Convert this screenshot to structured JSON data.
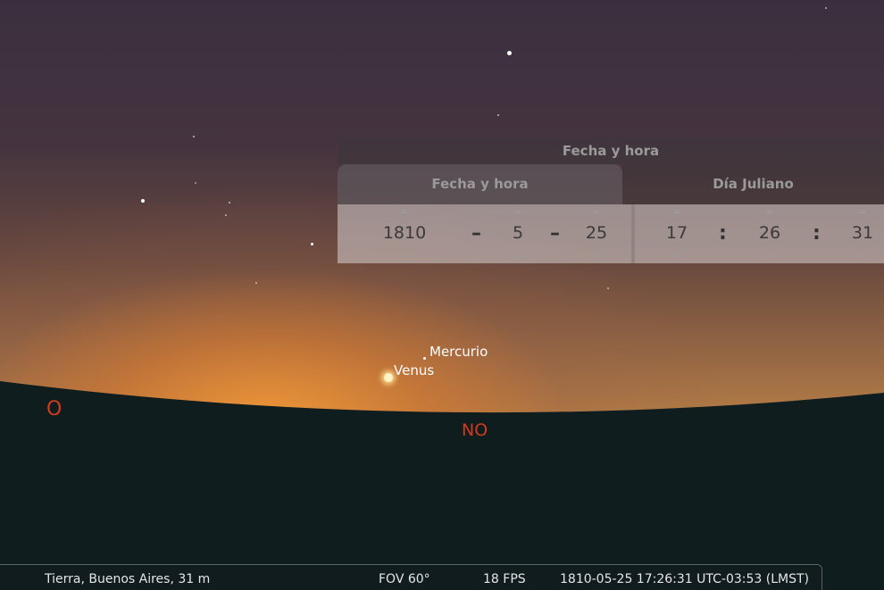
{
  "sky": {
    "planets": [
      {
        "label": "Mercurio"
      },
      {
        "label": "Venus"
      }
    ],
    "cardinals": {
      "west": "O",
      "northwest": "NO"
    }
  },
  "datetime_window": {
    "title": "Fecha y hora",
    "tabs": [
      {
        "label": "Fecha y hora",
        "active": true
      },
      {
        "label": "Día Juliano",
        "active": false
      }
    ],
    "date": {
      "year": "1810",
      "month": "5",
      "day": "25",
      "separator": "–"
    },
    "time": {
      "hour": "17",
      "minute": "26",
      "second": "31",
      "separator": ":"
    }
  },
  "statusbar": {
    "location": "Tierra, Buenos Aires, 31 m",
    "fov": "FOV 60°",
    "fps": "18 FPS",
    "datetime": "1810-05-25 17:26:31 UTC-03:53 (LMST)"
  },
  "colors": {
    "cardinal": "#d23a1e",
    "ground": "#0f1d1f",
    "horizon_glow": "#f0963a"
  }
}
